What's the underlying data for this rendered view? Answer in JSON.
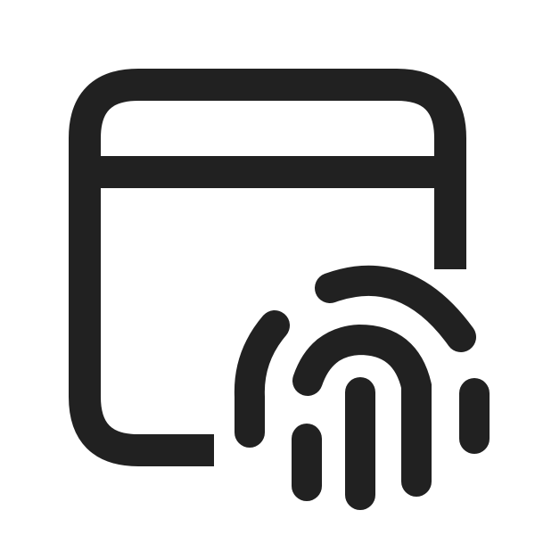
{
  "icon": {
    "name": "window-fingerprint-icon",
    "color": "#212121",
    "background": "#ffffff"
  }
}
